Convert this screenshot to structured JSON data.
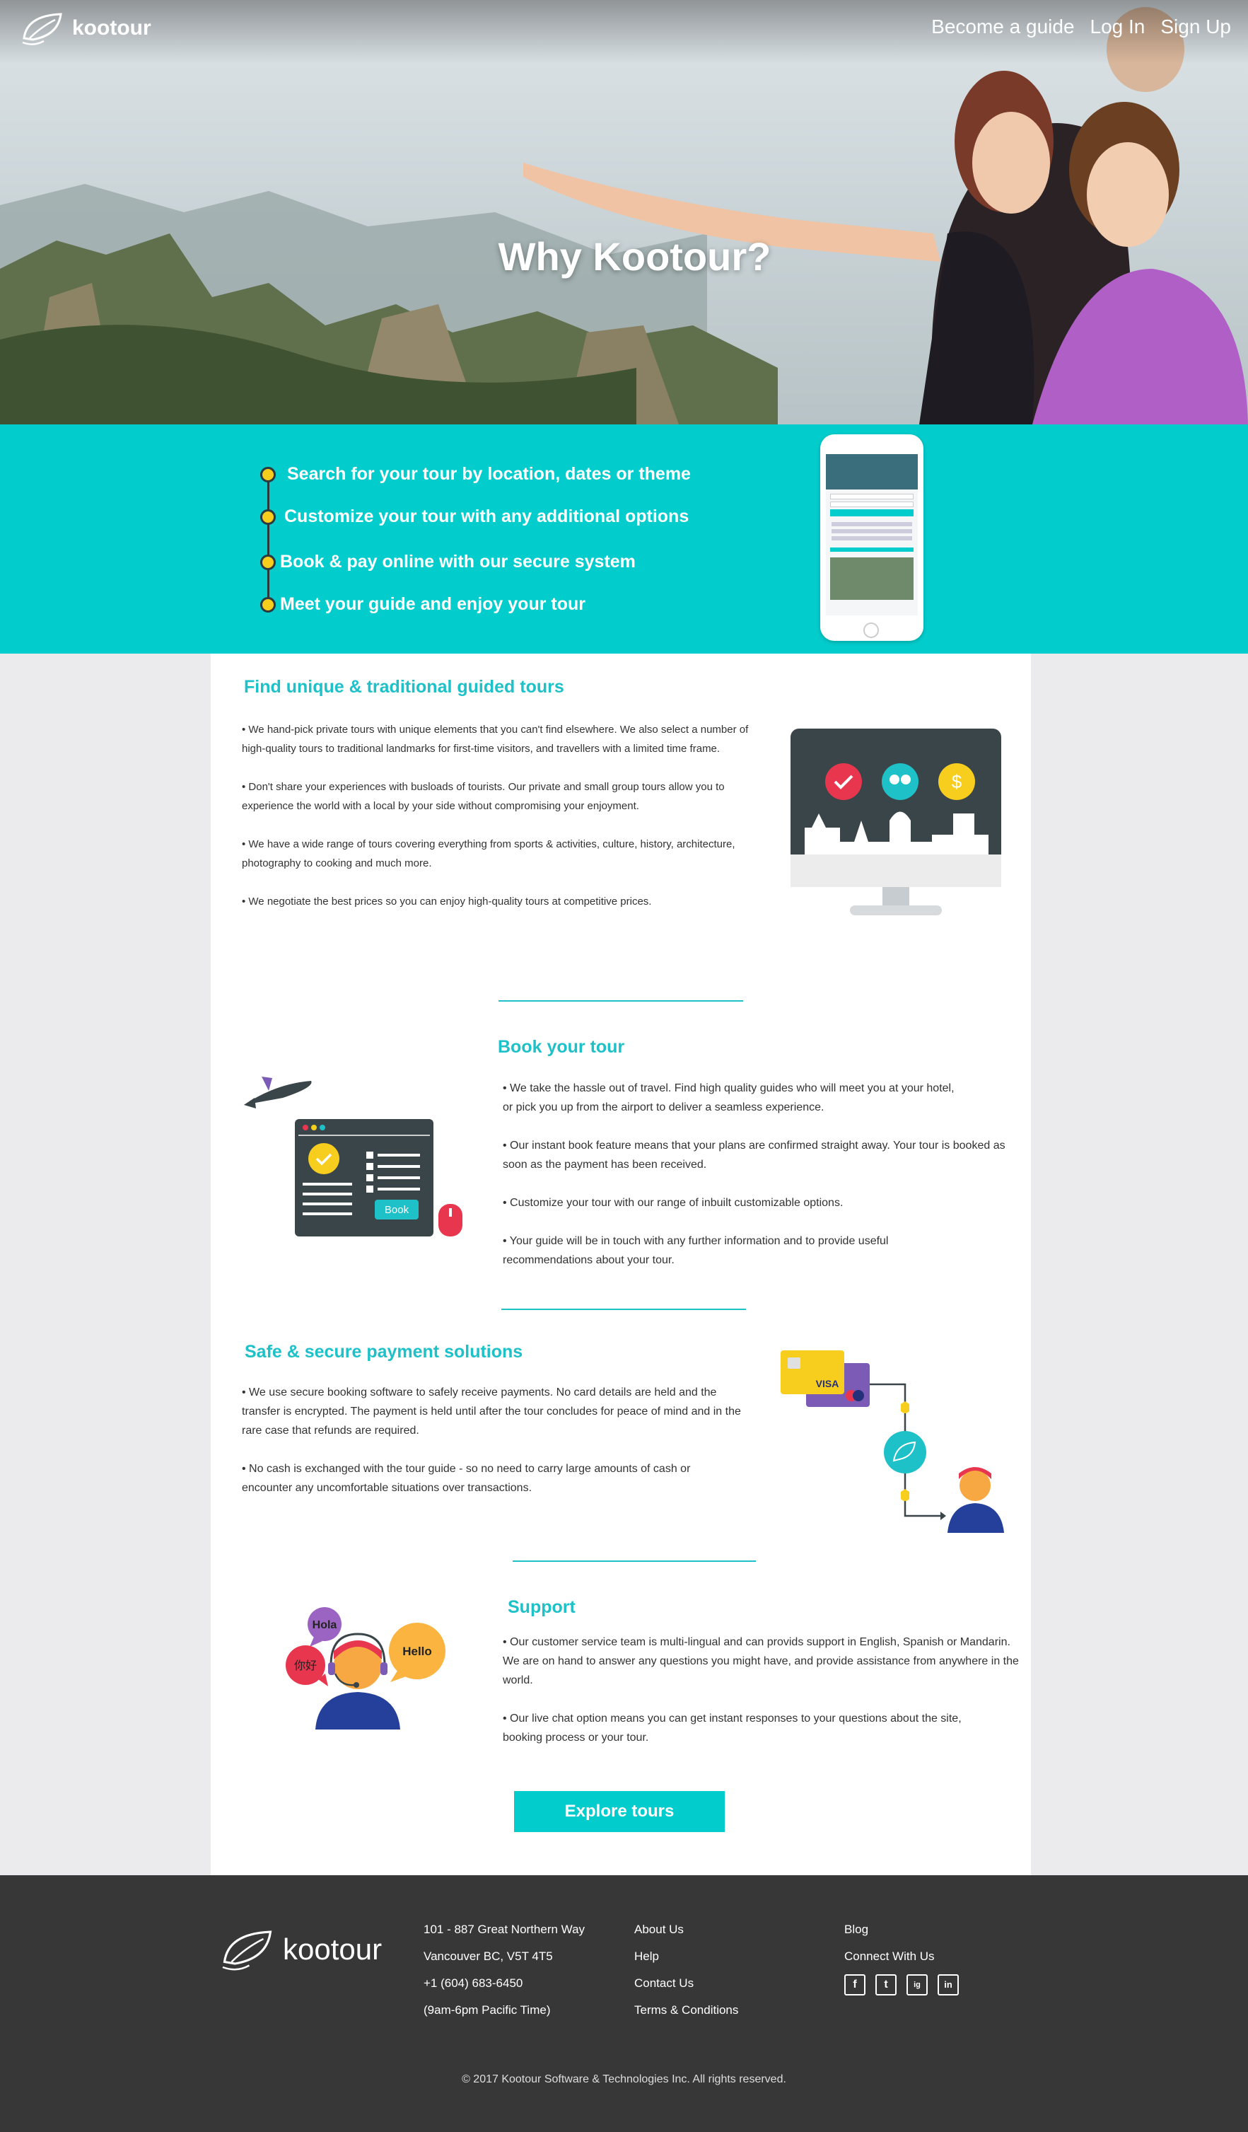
{
  "brand": {
    "name": "kootour"
  },
  "nav": {
    "become_guide": "Become a guide",
    "login": "Log In",
    "signup": "Sign Up"
  },
  "hero": {
    "title": "Why Kootour?"
  },
  "steps": [
    "Search for your tour by location, dates or theme",
    "Customize your tour with any additional options",
    "Book & pay online with our secure system",
    "Meet your guide and enjoy your tour"
  ],
  "sections": {
    "unique": {
      "title": "Find unique & traditional guided tours",
      "paragraphs": [
        "• We hand-pick private tours with unique elements that you can't find elsewhere. We also select a number of high-quality tours to traditional landmarks for first-time visitors, and travellers with a limited time frame.",
        "• Don't share your experiences with busloads of tourists. Our private and small group tours allow you to experience the world with a local by your side without compromising your enjoyment.",
        "• We have a wide range of tours covering everything from sports & activities, culture, history, architecture, photography to cooking and much more.",
        "• We negotiate the best prices so you can enjoy high-quality tours at competitive prices."
      ]
    },
    "book": {
      "title": "Book your tour",
      "book_label": "Book",
      "paragraphs": [
        "• We take the hassle out of travel. Find high quality guides who will meet you at your hotel, or pick you up from the airport to deliver a seamless experience.",
        "• Our instant book feature means that your plans are confirmed straight away. Your tour is booked as soon as the payment has been received.",
        "• Customize your tour with our range of inbuilt customizable  options.",
        "• Your guide will be in touch with any further information and to provide useful recommendations about your tour."
      ]
    },
    "payment": {
      "title": "Safe & secure payment solutions",
      "card_label": "VISA",
      "paragraphs": [
        "• We use secure booking software to safely receive payments. No card details are held and the transfer is encrypted.  The payment is held until after the tour concludes for peace of mind and in the rare case that refunds are required.",
        "• No cash is exchanged with the tour guide - so no need to carry large amounts of cash or encounter any    uncomfortable situations over transactions."
      ]
    },
    "support": {
      "title": "Support",
      "bubbles": {
        "hola": "Hola",
        "nihao": "你好",
        "hello": "Hello"
      },
      "paragraphs": [
        "• Our customer service team is multi-lingual and can provids support in English, Spanish or Mandarin. We are on hand to answer any questions you might have, and provide  assistance from anywhere in the world.",
        "• Our live chat option means you can get instant responses to  your questions about the site, booking process or your tour."
      ]
    }
  },
  "cta": {
    "explore": "Explore tours"
  },
  "footer": {
    "address": [
      "101 - 887 Great Northern Way",
      "Vancouver BC, V5T 4T5",
      "+1 (604) 683-6450",
      "(9am-6pm Pacific Time)"
    ],
    "links": [
      "About Us",
      "Help",
      "Contact Us",
      "Terms & Conditions"
    ],
    "blog": "Blog",
    "connect": "Connect With Us",
    "social": [
      "f",
      "t",
      "ig",
      "in"
    ],
    "copyright": "© 2017 Kootour Software & Technologies Inc. All rights reserved."
  },
  "colors": {
    "teal": "#03cccc",
    "heading_teal": "#1ec1c8",
    "footer": "#373738",
    "yellow": "#f7ce1e"
  }
}
